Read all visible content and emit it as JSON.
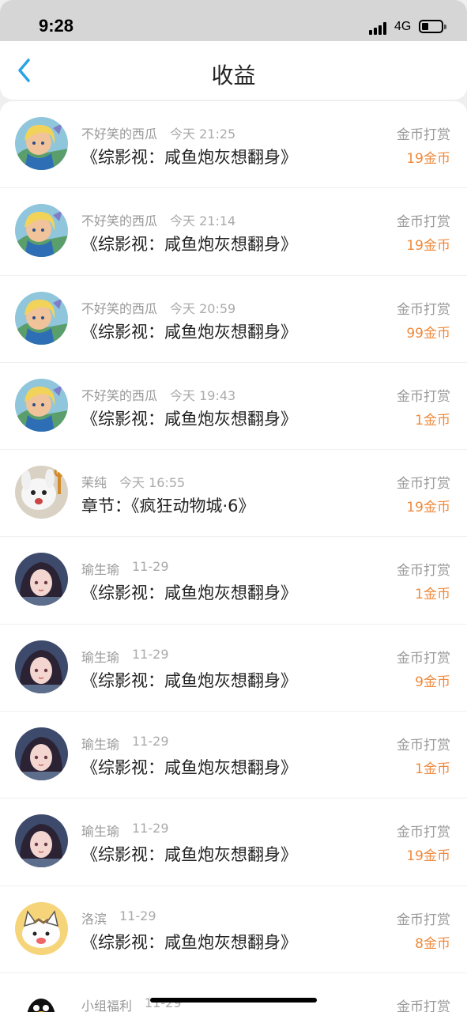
{
  "status": {
    "time": "9:28",
    "network": "4G"
  },
  "header": {
    "title": "收益"
  },
  "records": [
    {
      "user": "不好笑的西瓜",
      "time": "今天 21:25",
      "book": "《综影视：咸鱼炮灰想翻身》",
      "type": "金币打赏",
      "amount": "19金币",
      "avatar": "alice"
    },
    {
      "user": "不好笑的西瓜",
      "time": "今天 21:14",
      "book": "《综影视：咸鱼炮灰想翻身》",
      "type": "金币打赏",
      "amount": "19金币",
      "avatar": "alice"
    },
    {
      "user": "不好笑的西瓜",
      "time": "今天 20:59",
      "book": "《综影视：咸鱼炮灰想翻身》",
      "type": "金币打赏",
      "amount": "99金币",
      "avatar": "alice"
    },
    {
      "user": "不好笑的西瓜",
      "time": "今天 19:43",
      "book": "《综影视：咸鱼炮灰想翻身》",
      "type": "金币打赏",
      "amount": "1金币",
      "avatar": "alice"
    },
    {
      "user": "茉纯",
      "time": "今天 16:55",
      "book": "章节：《疯狂动物城·6》",
      "type": "金币打赏",
      "amount": "19金币",
      "avatar": "bunny"
    },
    {
      "user": "瑜生瑜",
      "time": "11-29",
      "book": "《综影视：咸鱼炮灰想翻身》",
      "type": "金币打赏",
      "amount": "1金币",
      "avatar": "girl"
    },
    {
      "user": "瑜生瑜",
      "time": "11-29",
      "book": "《综影视：咸鱼炮灰想翻身》",
      "type": "金币打赏",
      "amount": "9金币",
      "avatar": "girl"
    },
    {
      "user": "瑜生瑜",
      "time": "11-29",
      "book": "《综影视：咸鱼炮灰想翻身》",
      "type": "金币打赏",
      "amount": "1金币",
      "avatar": "girl"
    },
    {
      "user": "瑜生瑜",
      "time": "11-29",
      "book": "《综影视：咸鱼炮灰想翻身》",
      "type": "金币打赏",
      "amount": "19金币",
      "avatar": "girl"
    },
    {
      "user": "洛滨",
      "time": "11-29",
      "book": "《综影视：咸鱼炮灰想翻身》",
      "type": "金币打赏",
      "amount": "8金币",
      "avatar": "cat"
    },
    {
      "user": "小组福利",
      "time": "11-29",
      "book": "",
      "type": "金币打赏",
      "amount": "",
      "avatar": "penguin"
    }
  ]
}
